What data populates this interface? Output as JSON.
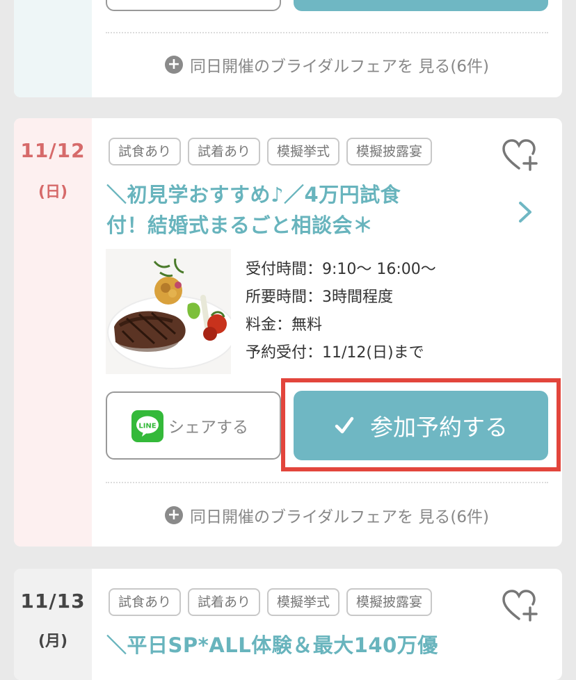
{
  "colors": {
    "accent": "#6fb7c3",
    "title_teal": "#68b4bd",
    "sunday_red": "#d66a6a",
    "highlight_red": "#e2453c",
    "line_green": "#34b93a"
  },
  "prev_event": {
    "more_label": "同日開催のブライダルフェアを 見る(6件)"
  },
  "event": {
    "date": "11/12",
    "dow": "(日)",
    "tags": [
      "試食あり",
      "試着あり",
      "模擬挙式",
      "模擬披露宴"
    ],
    "title_line1": "＼初見学おすすめ♪／4万円試食",
    "title_line2": "付！結婚式まるごと相談会＊",
    "info": {
      "reception": "受付時間：9:10〜 16:00〜",
      "duration": "所要時間：3時間程度",
      "fee": "料金：無料",
      "deadline": "予約受付：11/12(日)まで"
    },
    "line_icon_text": "LINE",
    "share_label": "シェアする",
    "reserve_label": "参加予約する",
    "more_label": "同日開催のブライダルフェアを 見る(6件)"
  },
  "next_event": {
    "date": "11/13",
    "dow": "(月)",
    "tags": [
      "試食あり",
      "試着あり",
      "模擬挙式",
      "模擬披露宴"
    ],
    "title_line1": "＼平日SP*ALL体験＆最大140万優"
  }
}
